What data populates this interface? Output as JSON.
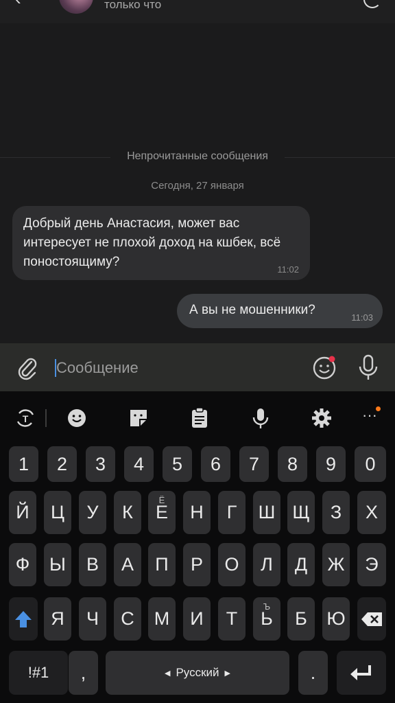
{
  "header": {
    "status": "только что"
  },
  "chat": {
    "unread_label": "Непрочитанные сообщения",
    "date_label": "Сегодня, 27 января",
    "messages": [
      {
        "direction": "incoming",
        "text": "Добрый день Анастасия, может вас интересует не плохой доход на кшбек, всё поностоящиму?",
        "time": "11:02"
      },
      {
        "direction": "outgoing",
        "text": "А вы не мошенники?",
        "time": "11:03"
      }
    ]
  },
  "composer": {
    "placeholder": "Сообщение"
  },
  "keyboard": {
    "toolbar_icons": [
      "translate-icon",
      "emoji-icon",
      "sticker-icon",
      "clipboard-icon",
      "mic-icon",
      "gear-icon",
      "more-icon"
    ],
    "rows": [
      [
        "1",
        "2",
        "3",
        "4",
        "5",
        "6",
        "7",
        "8",
        "9",
        "0"
      ],
      [
        "Й",
        "Ц",
        "У",
        "К",
        "Е",
        "Н",
        "Г",
        "Ш",
        "Щ",
        "З",
        "Х"
      ],
      [
        "Ф",
        "Ы",
        "В",
        "А",
        "П",
        "Р",
        "О",
        "Л",
        "Д",
        "Ж",
        "Э"
      ],
      [
        "Я",
        "Ч",
        "С",
        "М",
        "И",
        "Т",
        "Ь",
        "Б",
        "Ю"
      ]
    ],
    "e_alt": "Ё",
    "soft_alt": "Ъ",
    "symbols_label": "!#1",
    "comma_label": ",",
    "space_label": "Русский",
    "period_label": ".",
    "colors": {
      "accent": "#4a90e2",
      "notify": "#ff7a1a",
      "key_bg": "#2f2f31"
    }
  }
}
